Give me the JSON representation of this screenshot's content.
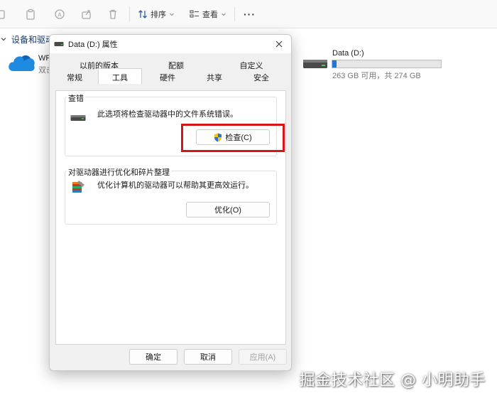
{
  "toolbar": {
    "sort_label": "排序",
    "view_label": "查看",
    "more_label": "···"
  },
  "explorer": {
    "section_header": "设备和驱动",
    "onedrive": {
      "name": "WP",
      "subtitle": "双击"
    },
    "drive": {
      "name": "Data (D:)",
      "space_text": "263 GB 可用，共 274 GB",
      "used_fraction": 0.04,
      "bar_color": "#1e78d4"
    }
  },
  "dialog": {
    "title": "Data (D:) 属性",
    "tabs_row1": [
      "以前的版本",
      "配额",
      "自定义"
    ],
    "tabs_row2": [
      "常规",
      "工具",
      "硬件",
      "共享",
      "安全"
    ],
    "active_tab": "工具",
    "error_check": {
      "label": "查错",
      "description": "此选项将检查驱动器中的文件系统错误。",
      "button": "检查(C)"
    },
    "optimize": {
      "label": "对驱动器进行优化和碎片整理",
      "description": "优化计算机的驱动器可以帮助其更高效运行。",
      "button": "优化(O)"
    },
    "footer": {
      "ok": "确定",
      "cancel": "取消",
      "apply": "应用(A)"
    }
  },
  "highlight_color": "#d8141b",
  "watermark": "掘金技术社区 @ 小明助手"
}
